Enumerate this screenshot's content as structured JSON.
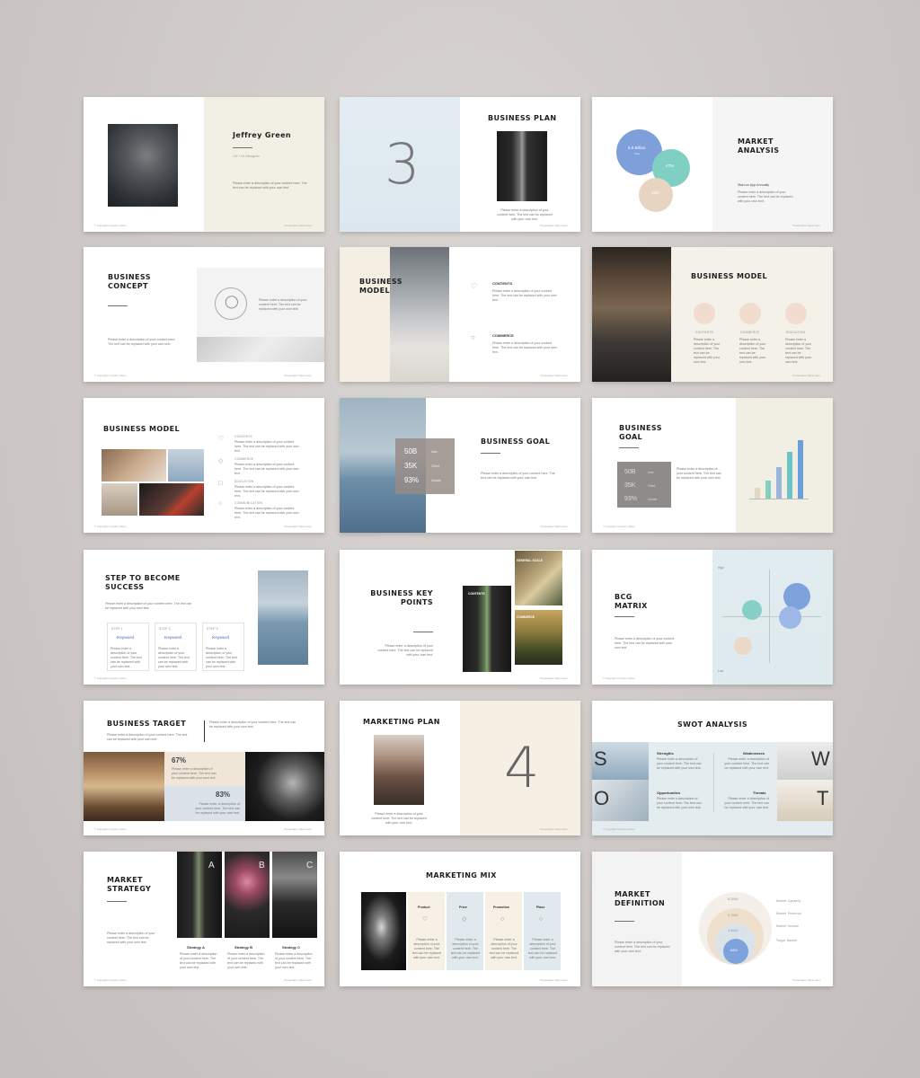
{
  "footer_left": "© Copyright Company Name",
  "footer_right": "Presentation Name Here",
  "placeholder_text": "Please enter a description of your content here. The text can be replaced with your own text.",
  "s1": {
    "name": "Jeffrey Green",
    "role": "UX / UI Designer"
  },
  "s2": {
    "number": "3",
    "title": "BUSINESS PLAN"
  },
  "s3": {
    "title": "MARKET\nANALYSIS",
    "c1": "6.8 Billion",
    "c1s": "User",
    "c2": "47M",
    "c2s": "93% User",
    "c3": "12M",
    "c3s": "Active",
    "caption": "Start-on Upp Annually"
  },
  "s4": {
    "title": "BUSINESS\nCONCEPT"
  },
  "s5": {
    "title": "BUSINESS\nMODEL",
    "item1": "CONTENTS",
    "item2": "COMMERCE"
  },
  "s6": {
    "title": "BUSINESS MODEL",
    "items": [
      "CONTENTS",
      "COMMERCE",
      "EDUCATION"
    ]
  },
  "s7": {
    "title": "BUSINESS MODEL",
    "items": [
      "CONTENTS",
      "COMMERCE",
      "EDUCATION",
      "COMMUNICATION"
    ]
  },
  "s8": {
    "title": "BUSINESS GOAL",
    "stats": [
      "50B",
      "35K",
      "93%"
    ],
    "labels": [
      "User",
      "Client",
      "Growth"
    ]
  },
  "s9": {
    "title": "BUSINESS\nGOAL",
    "stats": [
      "50B",
      "35K",
      "93%"
    ],
    "labels": [
      "User",
      "Client",
      "Growth"
    ]
  },
  "s10": {
    "title": "STEP TO BECOME\nSUCCESS",
    "steps": [
      "STEP 1",
      "STEP 2",
      "STEP 3"
    ],
    "keyword": "Keyword"
  },
  "s11": {
    "title": "BUSINESS KEY\nPOINTS",
    "l1": "CONTENTS",
    "l2": "GENERAL SCALE",
    "l3": "COMMERCE"
  },
  "s12": {
    "title": "BCG\nMATRIX",
    "high": "High",
    "low": "Low"
  },
  "s13": {
    "title": "BUSINESS TARGET",
    "p1": "67%",
    "p2": "83%"
  },
  "s14": {
    "title": "MARKETING PLAN",
    "number": "4"
  },
  "s15": {
    "title": "SWOT ANALYSIS",
    "letters": [
      "S",
      "W",
      "O",
      "T"
    ],
    "labels": [
      "Strengths",
      "Weaknesses",
      "Opportunities",
      "Threats"
    ]
  },
  "s16": {
    "title": "MARKET\nSTRATEGY",
    "letters": [
      "A",
      "B",
      "C"
    ],
    "labels": [
      "Strategy A",
      "Strategy B",
      "Strategy C"
    ]
  },
  "s17": {
    "title": "MARKETING MIX",
    "cols": [
      "Product",
      "Price",
      "Promotion",
      "Place"
    ]
  },
  "s18": {
    "title": "MARKET\nDEFINITION",
    "values": [
      "8.2MM",
      "5.7MM",
      "3.5MM",
      "84%"
    ],
    "labels": [
      "Market Capacity",
      "Market Potential",
      "Market Volume",
      "Target Market"
    ]
  }
}
